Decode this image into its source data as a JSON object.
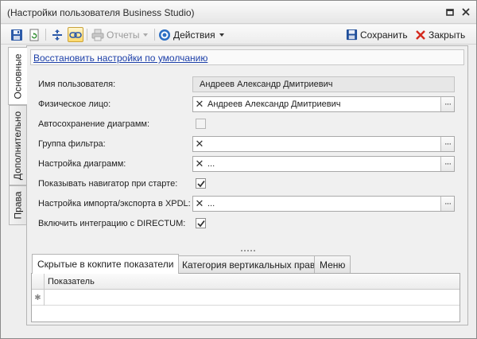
{
  "window": {
    "title": "(Настройки пользователя Business Studio)"
  },
  "toolbar": {
    "reports_label": "Отчеты",
    "actions_label": "Действия",
    "save_label": "Сохранить",
    "close_label": "Закрыть"
  },
  "side_tabs": [
    "Основные",
    "Дополнительно",
    "Права"
  ],
  "restore_link": "Восстановить настройки по умолчанию",
  "form": {
    "user_name": {
      "label": "Имя пользователя:",
      "value": "Андреев Александр Дмитриевич"
    },
    "person": {
      "label": "Физическое лицо:",
      "value": "Андреев Александр Дмитриевич"
    },
    "autosave": {
      "label": "Автосохранение диаграмм:",
      "checked": false
    },
    "filter_group": {
      "label": "Группа фильтра:",
      "value": ""
    },
    "diagram_settings": {
      "label": "Настройка диаграмм:",
      "value": "..."
    },
    "show_navigator": {
      "label": "Показывать навигатор при старте:",
      "checked": true
    },
    "xpdl_settings": {
      "label": "Настройка импорта/экспорта в XPDL:",
      "value": "..."
    },
    "directum": {
      "label": "Включить интеграцию с DIRECTUM:",
      "checked": true
    }
  },
  "bottom_tabs": [
    "Скрытые в кокпите показатели",
    "Категория вертикальных прав",
    "Меню"
  ],
  "grid": {
    "column": "Показатель",
    "new_row_marker": "✱"
  },
  "colors": {
    "accent_blue": "#1c3fa8",
    "close_red": "#d42a1e",
    "save_blue": "#1f4e9a"
  }
}
